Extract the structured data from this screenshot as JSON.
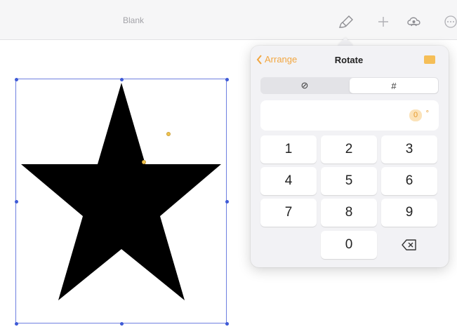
{
  "document": {
    "title": "Blank"
  },
  "toolbar": {
    "icons": [
      "paintbrush-icon",
      "plus-icon",
      "share-collaborate-icon",
      "more-icon"
    ]
  },
  "popover": {
    "back_label": "Arrange",
    "title": "Rotate",
    "segments": [
      {
        "label": "⊘",
        "icon": "dial-icon",
        "selected": false
      },
      {
        "label": "#",
        "icon": "number-icon",
        "selected": true
      }
    ],
    "value": "0",
    "unit": "°",
    "keys": [
      "1",
      "2",
      "3",
      "4",
      "5",
      "6",
      "7",
      "8",
      "9",
      "0"
    ],
    "delete_icon": "backspace-icon"
  },
  "colors": {
    "accent": "#f2a640",
    "selection": "#3f5bd6",
    "shape_fill": "#000000",
    "popover_bg": "#f2f2f5"
  }
}
